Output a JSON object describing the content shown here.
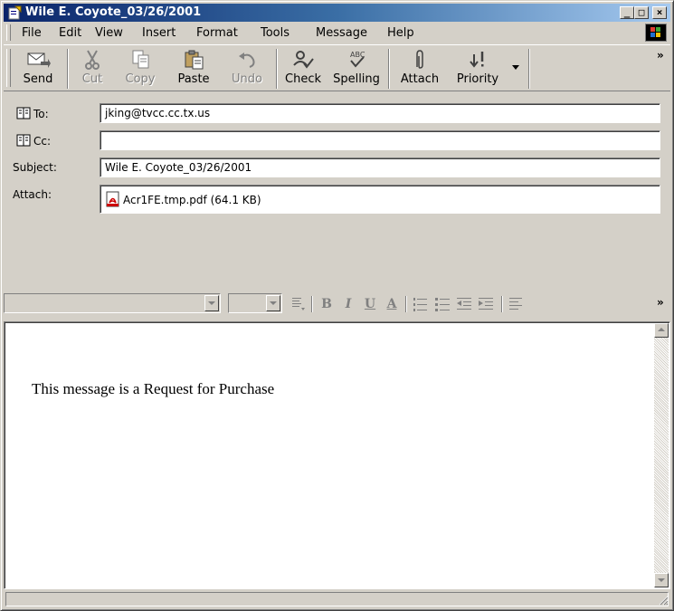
{
  "window": {
    "title": "Wile E. Coyote_03/26/2001",
    "controls": {
      "minimize": "_",
      "maximize": "□",
      "close": "×"
    }
  },
  "menu": [
    "File",
    "Edit",
    "View",
    "Insert",
    "Format",
    "Tools",
    "Message",
    "Help"
  ],
  "toolbar": {
    "send": "Send",
    "cut": "Cut",
    "copy": "Copy",
    "paste": "Paste",
    "undo": "Undo",
    "check": "Check",
    "spelling": "Spelling",
    "attach": "Attach",
    "priority": "Priority",
    "overflow": "»"
  },
  "header": {
    "to_label": "To:",
    "to_value": "jking@tvcc.cc.tx.us",
    "cc_label": "Cc:",
    "cc_value": "",
    "subject_label": "Subject:",
    "subject_value": "Wile E. Coyote_03/26/2001",
    "attach_label": "Attach:",
    "attachment": "Acr1FE.tmp.pdf (64.1 KB)"
  },
  "format_toolbar": {
    "bold": "B",
    "italic": "I",
    "underline": "U",
    "font_color": "A",
    "overflow": "»"
  },
  "message": {
    "body": "This message is a Request for Purchase"
  },
  "icons": {
    "title": "compose-note-icon",
    "send": "send-envelope-icon",
    "cut": "scissors-icon",
    "copy": "copy-icon",
    "paste": "paste-icon",
    "undo": "undo-icon",
    "check": "check-names-icon",
    "spelling": "spelling-icon",
    "attach": "paperclip-icon",
    "priority": "priority-icon",
    "address_book": "address-book-icon",
    "attachment_file": "pdf-file-icon"
  },
  "colors": {
    "titlebar_start": "#0a246a",
    "titlebar_end": "#a6caf0",
    "face": "#d4d0c8"
  }
}
